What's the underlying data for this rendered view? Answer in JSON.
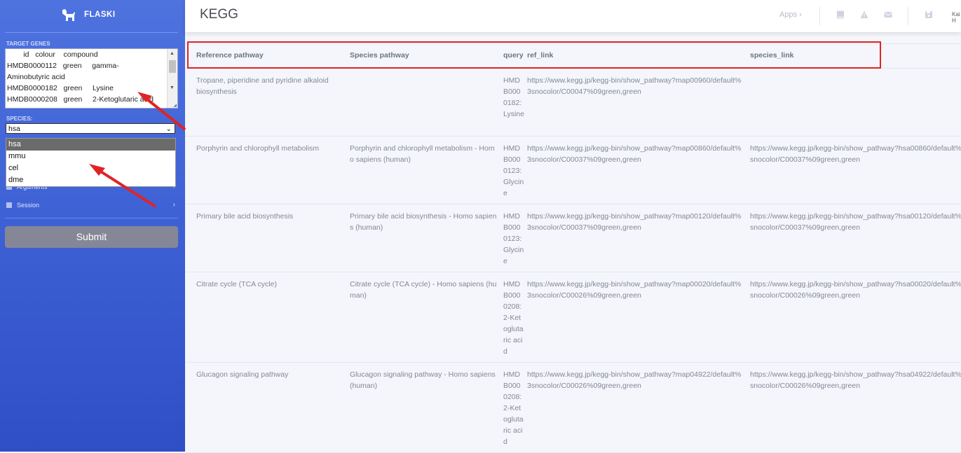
{
  "brand": {
    "name": "FLASKI"
  },
  "sidebar": {
    "target_genes_label": "TARGET GENES",
    "genes_rows": [
      "        id   colour    compound",
      "HMDB0000112   green     gamma-",
      "Aminobutyric acid",
      "HMDB0000182   green     Lysine",
      "HMDB0000208   green     2-Ketoglutaric acid"
    ],
    "species_label": "SPECIES:",
    "species_selected": "hsa",
    "species_options": [
      "hsa",
      "mmu",
      "cel",
      "dme"
    ],
    "nav": [
      {
        "label": "Arguments"
      },
      {
        "label": "Session"
      }
    ],
    "submit_label": "Submit"
  },
  "topbar": {
    "title": "KEGG",
    "apps_label": "Apps",
    "user_label": "Kai H"
  },
  "table": {
    "headers": [
      "Reference pathway",
      "Species pathway",
      "query",
      "ref_link",
      "species_link"
    ],
    "rows": [
      {
        "ref": "Tropane, piperidine and pyridine alkaloid biosynthesis",
        "species": "",
        "query": "HMDB0000182:Lysine",
        "ref_link": "https://www.kegg.jp/kegg-bin/show_pathway?map00960/default%3snocolor/C00047%09green,green",
        "species_link": ""
      },
      {
        "ref": "Porphyrin and chlorophyll metabolism",
        "species": "Porphyrin and chlorophyll metabolism - Homo sapiens (human)",
        "query": "HMDB0000123:Glycine",
        "ref_link": "https://www.kegg.jp/kegg-bin/show_pathway?map00860/default%3snocolor/C00037%09green,green",
        "species_link": "https://www.kegg.jp/kegg-bin/show_pathway?hsa00860/default%3snocolor/C00037%09green,green"
      },
      {
        "ref": "Primary bile acid biosynthesis",
        "species": "Primary bile acid biosynthesis - Homo sapiens (human)",
        "query": "HMDB0000123:Glycine",
        "ref_link": "https://www.kegg.jp/kegg-bin/show_pathway?map00120/default%3snocolor/C00037%09green,green",
        "species_link": "https://www.kegg.jp/kegg-bin/show_pathway?hsa00120/default%3snocolor/C00037%09green,green"
      },
      {
        "ref": "Citrate cycle (TCA cycle)",
        "species": "Citrate cycle (TCA cycle) - Homo sapiens (human)",
        "query": "HMDB0000208:2-Ketoglutaric acid",
        "ref_link": "https://www.kegg.jp/kegg-bin/show_pathway?map00020/default%3snocolor/C00026%09green,green",
        "species_link": "https://www.kegg.jp/kegg-bin/show_pathway?hsa00020/default%3snocolor/C00026%09green,green"
      },
      {
        "ref": "Glucagon signaling pathway",
        "species": "Glucagon signaling pathway - Homo sapiens (human)",
        "query": "HMDB0000208:2-Ketoglutaric acid",
        "ref_link": "https://www.kegg.jp/kegg-bin/show_pathway?map04922/default%3snocolor/C00026%09green,green",
        "species_link": "https://www.kegg.jp/kegg-bin/show_pathway?hsa04922/default%3snocolor/C00026%09green,green"
      }
    ]
  },
  "colors": {
    "sidebar_top": "#4e73df",
    "sidebar_bottom": "#2f4fc6",
    "annotation_red": "#e02424",
    "dropdown_selected": "#6b6b6b",
    "submit_bg": "#858796"
  },
  "icons": [
    "dog-logo-icon",
    "chevron-right-icon",
    "book-icon",
    "warning-icon",
    "envelope-icon",
    "save-icon"
  ]
}
